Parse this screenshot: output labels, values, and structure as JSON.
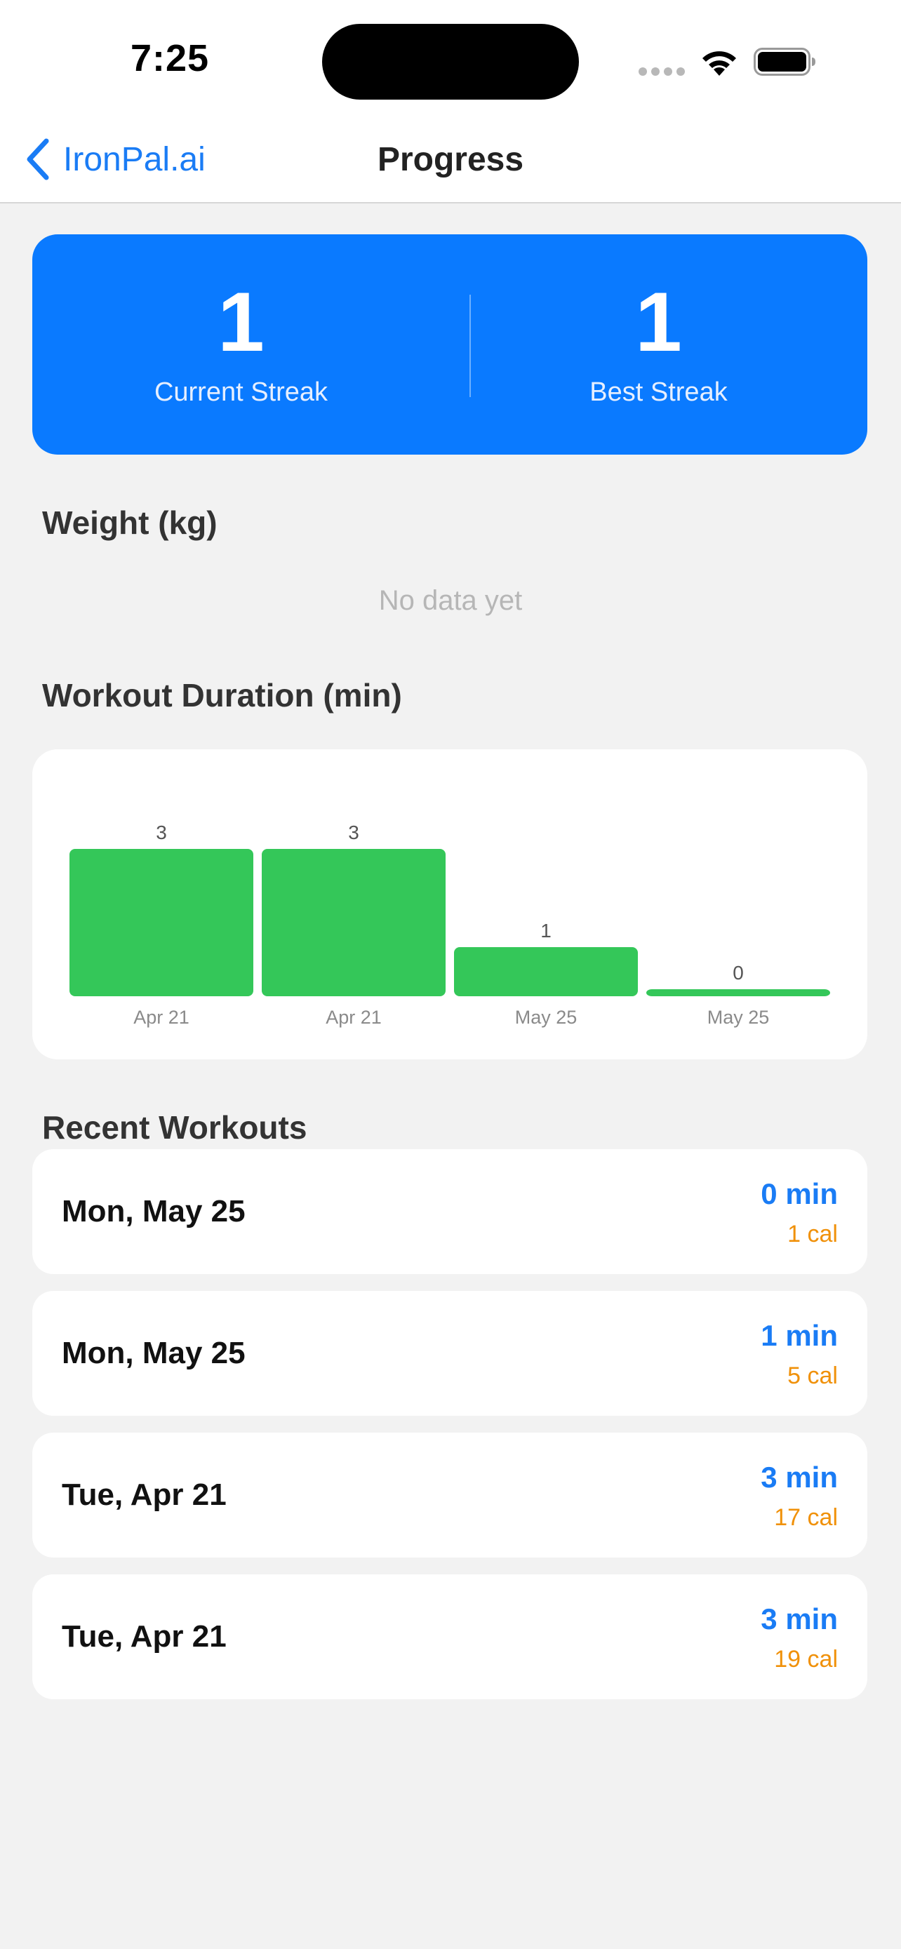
{
  "status_bar": {
    "time": "7:25"
  },
  "nav": {
    "back_label": "IronPal.ai",
    "title": "Progress"
  },
  "streak": {
    "current_value": "1",
    "current_label": "Current Streak",
    "best_value": "1",
    "best_label": "Best Streak"
  },
  "weight": {
    "heading": "Weight (kg)",
    "empty_text": "No data yet"
  },
  "duration": {
    "heading": "Workout Duration (min)"
  },
  "recent": {
    "heading": "Recent Workouts",
    "items": [
      {
        "date": "Mon, May 25",
        "duration": "0 min",
        "calories": "1 cal"
      },
      {
        "date": "Mon, May 25",
        "duration": "1 min",
        "calories": "5 cal"
      },
      {
        "date": "Tue, Apr 21",
        "duration": "3 min",
        "calories": "17 cal"
      },
      {
        "date": "Tue, Apr 21",
        "duration": "3 min",
        "calories": "19 cal"
      }
    ]
  },
  "colors": {
    "accent": "#0a7aff",
    "bar": "#34c759",
    "calories": "#f0910a"
  },
  "chart_data": {
    "type": "bar",
    "categories": [
      "Apr 21",
      "Apr 21",
      "May 25",
      "May 25"
    ],
    "values": [
      3,
      3,
      1,
      0
    ],
    "title": "Workout Duration (min)",
    "xlabel": "",
    "ylabel": "",
    "ylim": [
      0,
      3
    ],
    "grid": false,
    "bar_color": "#34c759"
  }
}
